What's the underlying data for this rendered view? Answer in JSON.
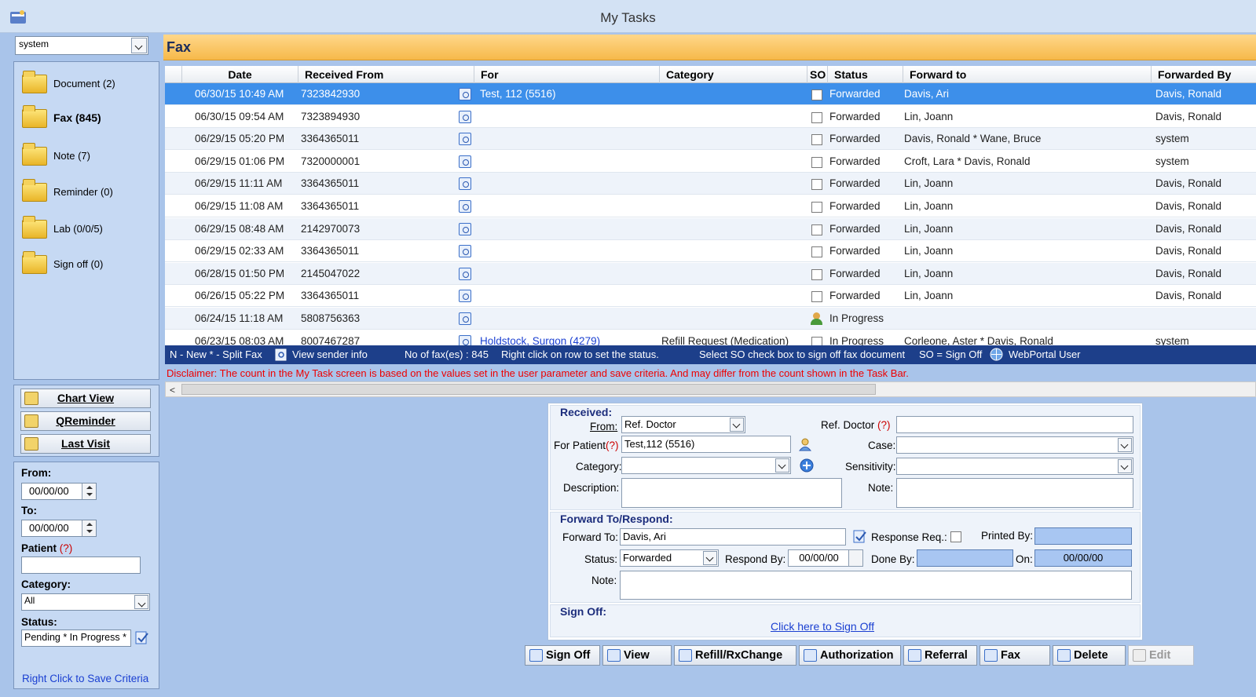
{
  "window": {
    "title": "My Tasks"
  },
  "user_select": {
    "value": "system"
  },
  "nav": [
    {
      "label": "Document (2)",
      "icon": "document-folder-icon",
      "active": false
    },
    {
      "label": "Fax (845)",
      "icon": "fax-folder-icon",
      "active": true
    },
    {
      "label": "Note (7)",
      "icon": "note-folder-icon",
      "active": false
    },
    {
      "label": "Reminder (0)",
      "icon": "reminder-folder-icon",
      "active": false
    },
    {
      "label": "Lab (0/0/5)",
      "icon": "lab-folder-icon",
      "active": false
    },
    {
      "label": "Sign off (0)",
      "icon": "signoff-folder-icon",
      "active": false
    }
  ],
  "left_buttons": {
    "chart_view": "Chart View",
    "qreminder": "QReminder",
    "last_visit": "Last Visit"
  },
  "filters": {
    "from_label": "From:",
    "from_value": "00/00/00",
    "to_label": "To:",
    "to_value": "00/00/00",
    "patient_label": "Patient",
    "patient_q": "(?)",
    "patient_value": "",
    "category_label": "Category:",
    "category_value": "All",
    "status_label": "Status:",
    "status_value": "Pending * In Progress *",
    "save_criteria": "Right Click to Save Criteria"
  },
  "section_title": "Fax",
  "grid": {
    "columns": [
      "Date",
      "Received From",
      "For",
      "Category",
      "SO",
      "Status",
      "Forward to",
      "Forwarded By"
    ],
    "rows": [
      {
        "date": "06/30/15 10:49 AM",
        "from": "7323842930",
        "for": "Test, 112  (5516)",
        "category": "",
        "so": "check",
        "status": "Forwarded",
        "forward_to": "Davis, Ari",
        "forwarded_by": "Davis, Ronald",
        "selected": true
      },
      {
        "date": "06/30/15 09:54 AM",
        "from": "7323894930",
        "for": "",
        "category": "",
        "so": "check",
        "status": "Forwarded",
        "forward_to": "Lin, Joann",
        "forwarded_by": "Davis, Ronald"
      },
      {
        "date": "06/29/15 05:20 PM",
        "from": "3364365011",
        "for": "",
        "category": "",
        "so": "check",
        "status": "Forwarded",
        "forward_to": "Davis, Ronald * Wane, Bruce",
        "forwarded_by": "system"
      },
      {
        "date": "06/29/15 01:06 PM",
        "from": "7320000001",
        "for": "",
        "category": "",
        "so": "check",
        "status": "Forwarded",
        "forward_to": "Croft, Lara * Davis, Ronald",
        "forwarded_by": "system"
      },
      {
        "date": "06/29/15 11:11 AM",
        "from": "3364365011",
        "for": "",
        "category": "",
        "so": "check",
        "status": "Forwarded",
        "forward_to": "Lin, Joann",
        "forwarded_by": "Davis, Ronald"
      },
      {
        "date": "06/29/15 11:08 AM",
        "from": "3364365011",
        "for": "",
        "category": "",
        "so": "check",
        "status": "Forwarded",
        "forward_to": "Lin, Joann",
        "forwarded_by": "Davis, Ronald"
      },
      {
        "date": "06/29/15 08:48 AM",
        "from": "2142970073",
        "for": "",
        "category": "",
        "so": "check",
        "status": "Forwarded",
        "forward_to": "Lin, Joann",
        "forwarded_by": "Davis, Ronald"
      },
      {
        "date": "06/29/15 02:33 AM",
        "from": "3364365011",
        "for": "",
        "category": "",
        "so": "check",
        "status": "Forwarded",
        "forward_to": "Lin, Joann",
        "forwarded_by": "Davis, Ronald"
      },
      {
        "date": "06/28/15 01:50 PM",
        "from": "2145047022",
        "for": "",
        "category": "",
        "so": "check",
        "status": "Forwarded",
        "forward_to": "Lin, Joann",
        "forwarded_by": "Davis, Ronald"
      },
      {
        "date": "06/26/15 05:22 PM",
        "from": "3364365011",
        "for": "",
        "category": "",
        "so": "check",
        "status": "Forwarded",
        "forward_to": "Lin, Joann",
        "forwarded_by": "Davis, Ronald"
      },
      {
        "date": "06/24/15 11:18 AM",
        "from": "5808756363",
        "for": "",
        "category": "",
        "so": "progress",
        "status": "In Progress",
        "forward_to": "",
        "forwarded_by": ""
      },
      {
        "date": "06/23/15 08:03 AM",
        "from": "8007467287",
        "for": "Holdstock, Surgon  (4279)",
        "category": "Refill Request (Medication)",
        "so": "check",
        "status": "In Progress",
        "forward_to": "Corleone, Aster * Davis, Ronald",
        "forwarded_by": "system"
      }
    ]
  },
  "statusbar": {
    "legend": "N - New  * - Split Fax",
    "sender": "View sender info",
    "count": "No of fax(es) : 845",
    "hint": "Right click on row to set the status.",
    "so_hint": "Select SO check box to sign off fax document",
    "so_def": "SO = Sign Off",
    "webportal": "WebPortal User"
  },
  "disclaimer": "Disclaimer: The count in the My Task screen is based on the values set in the user parameter and save criteria. And may differ from the count shown in the Task Bar.",
  "detail": {
    "received_title": "Received:",
    "from_label": "From:",
    "from_value": "Ref. Doctor",
    "refdoc_label": "Ref. Doctor",
    "refdoc_q": "(?)",
    "refdoc_value": "",
    "patient_label": "For Patient",
    "patient_q": "(?)",
    "patient_value": "Test,112 (5516)",
    "case_label": "Case:",
    "case_value": "",
    "category_label": "Category:",
    "category_value": "",
    "sensitivity_label": "Sensitivity:",
    "sensitivity_value": "",
    "description_label": "Description:",
    "description_value": "",
    "note_label": "Note:",
    "note_value": "",
    "forward_title": "Forward To/Respond:",
    "forward_label": "Forward To:",
    "forward_value": "Davis, Ari",
    "response_label": "Response Req.:",
    "printed_label": "Printed By:",
    "printed_value": "",
    "status_label": "Status:",
    "status_value": "Forwarded",
    "respond_label": "Respond By:",
    "respond_value": "00/00/00",
    "done_label": "Done By:",
    "done_value": "",
    "on_label": "On:",
    "on_value": "00/00/00",
    "note2_label": "Note:",
    "note2_value": "",
    "signoff_title": "Sign Off:",
    "signoff_link": "Click here to Sign Off"
  },
  "actions": [
    "Sign Off",
    "View",
    "Refill/RxChange",
    "Authorization",
    "Referral",
    "Fax",
    "Delete",
    "Edit"
  ]
}
